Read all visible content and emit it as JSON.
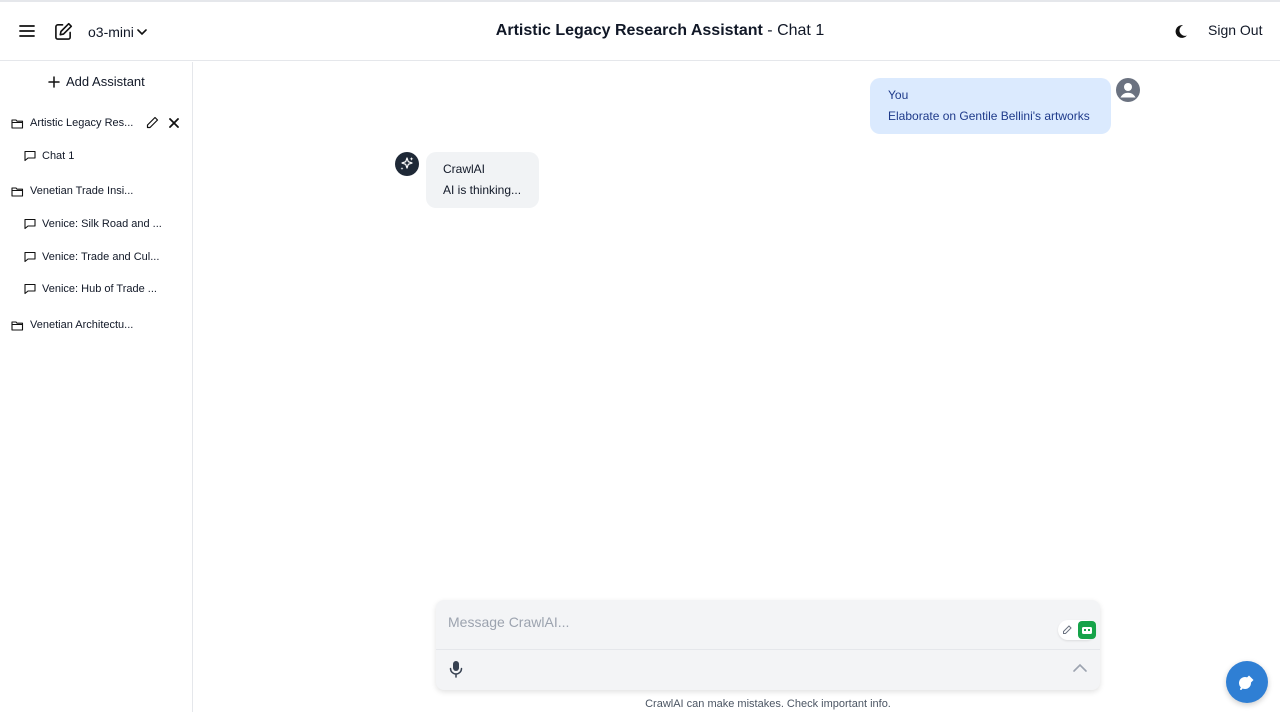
{
  "header": {
    "model": "o3-mini",
    "title_bold": "Artistic Legacy Research Assistant",
    "title_rest": " - Chat 1",
    "sign_out": "Sign Out"
  },
  "sidebar": {
    "add_assistant": "Add Assistant",
    "folders": [
      {
        "label": "Artistic Legacy Res...",
        "chats": [
          "Chat 1"
        ]
      },
      {
        "label": "Venetian Trade Insi...",
        "chats": [
          "Venice: Silk Road and ...",
          "Venice: Trade and Cul...",
          "Venice: Hub of Trade ..."
        ]
      },
      {
        "label": "Venetian Architectu...",
        "chats": []
      }
    ]
  },
  "messages": {
    "user": {
      "sender": "You",
      "text": "Elaborate on Gentile Bellini's artworks"
    },
    "ai": {
      "sender": "CrawlAI",
      "text": "AI is thinking..."
    }
  },
  "composer": {
    "placeholder": "Message CrawlAI...",
    "disclaimer": "CrawlAI can make mistakes. Check important info."
  },
  "colors": {
    "user_bubble": "#dbeafe",
    "ai_bubble": "#f1f3f5",
    "fab": "#2f7fd4",
    "extension_green": "#16a34a"
  },
  "icons": [
    "menu-icon",
    "compose-icon",
    "chevron-down-icon",
    "moon-icon",
    "plus-icon",
    "folder-icon",
    "pencil-icon",
    "close-icon",
    "chat-bubble-icon",
    "user-avatar-icon",
    "sparkle-icon",
    "microphone-icon",
    "chevron-up-icon",
    "chat-fab-icon"
  ]
}
